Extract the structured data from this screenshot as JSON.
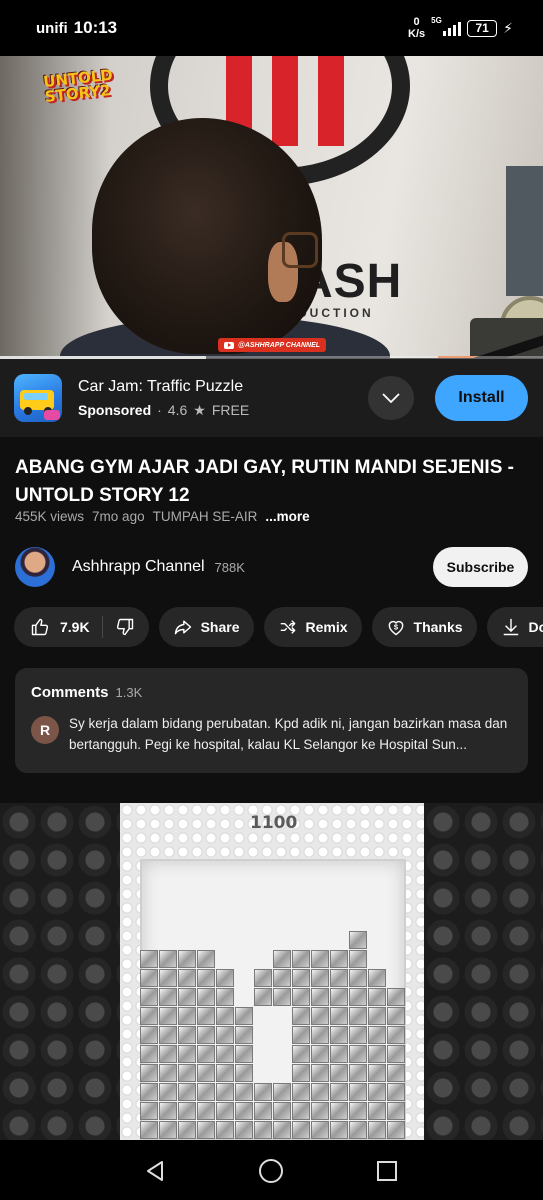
{
  "status_bar": {
    "carrier": "unifi",
    "time": "10:13",
    "net_speed_value": "0",
    "net_speed_unit": "K/s",
    "network_type": "5G",
    "battery_level": "71"
  },
  "video": {
    "show_logo_line1": "UNTOLD",
    "show_logo_line2": "STORY2",
    "watermark": "@ASHHRAPP CHANNEL",
    "background_sign": "ASH",
    "background_sign_sub": "DUCTION",
    "progress_fraction": 0.38
  },
  "ad": {
    "app_name": "Car Jam: Traffic Puzzle",
    "sponsored_label": "Sponsored",
    "rating": "4.6",
    "price": "FREE",
    "install_label": "Install"
  },
  "video_info": {
    "title": "ABANG GYM AJAR JADI GAY, RUTIN MANDI SEJENIS - UNTOLD STORY 12",
    "views": "455K views",
    "age": "7mo ago",
    "tag": "TUMPAH SE-AIR",
    "more_label": "...more"
  },
  "channel": {
    "name": "Ashhrapp Channel",
    "subscribers": "788K",
    "subscribe_label": "Subscribe"
  },
  "actions": {
    "likes": "7.9K",
    "share": "Share",
    "remix": "Remix",
    "thanks": "Thanks",
    "download": "Download"
  },
  "comments": {
    "title": "Comments",
    "count": "1.3K",
    "top_comment_initial": "R",
    "top_comment_text": "Sy kerja dalam bidang perubatan. Kpd adik ni, jangan bazirkan masa dan bertangguh. Pegi ke hospital, kalau KL Selangor ke Hospital Sun..."
  },
  "game_ad": {
    "score": "1100"
  },
  "colors": {
    "background": "#0f0f0f",
    "install_blue": "#3ea6ff",
    "pill_bg": "#272727"
  }
}
